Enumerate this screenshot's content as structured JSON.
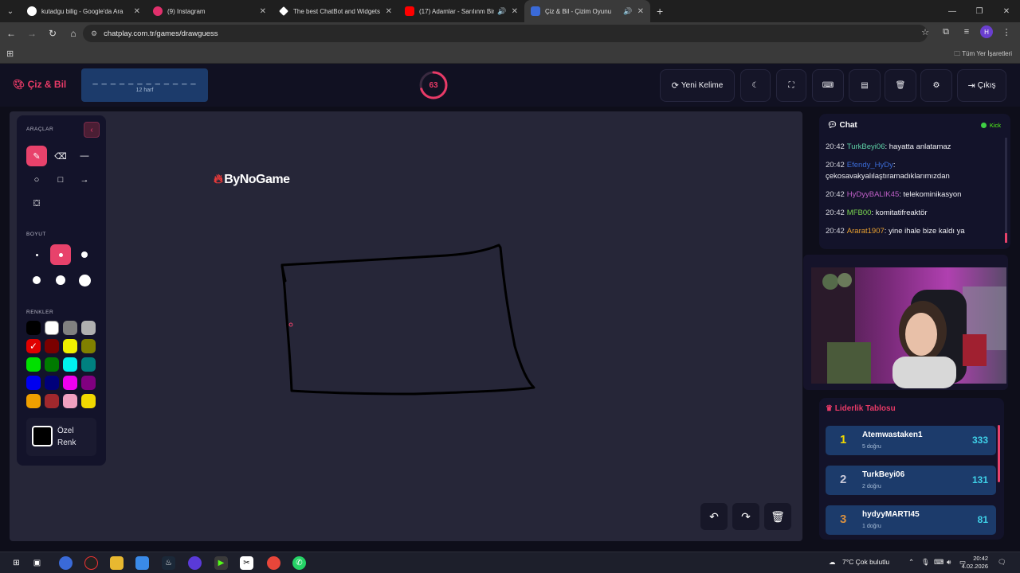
{
  "browser": {
    "tabs": [
      {
        "label": "kutadgu bilig - Google'da Ara",
        "color": "#ffffff",
        "icon": "google-icon"
      },
      {
        "label": "(9) Instagram",
        "color": "#e1306c",
        "icon": "instagram-icon"
      },
      {
        "label": "The best ChatBot and Widgets",
        "color": "#ffffff",
        "icon": "diamond-icon"
      },
      {
        "label": "(17) Adamlar - Sarılınm Birin",
        "color": "#ff0000",
        "icon": "youtube-icon"
      },
      {
        "label": "Çiz & Bil - Çizim Oyunu",
        "color": "#3a6ad8",
        "icon": "chatplay-icon"
      }
    ],
    "url": "chatplay.com.tr/games/drawguess",
    "bookmarks_all": "Tüm Yer İşaretleri",
    "profile_initial": "H"
  },
  "header": {
    "logo": "Çiz & Bil",
    "word_mask": "_ _ _ _ _ _ _ _ _ _ _ _",
    "letter_count": "12 harf",
    "timer": "63",
    "timer_fraction": 0.7,
    "new_word": "Yeni Kelime",
    "logout": "Çıkış"
  },
  "tools": {
    "section_tools": "ARAÇLAR",
    "section_size": "BOYUT",
    "section_colors": "RENKLER",
    "colors": [
      "#000000",
      "#ffffff",
      "#808080",
      "#b0b0b0",
      "#e00000",
      "#7a0000",
      "#f0f000",
      "#808000",
      "#00e000",
      "#007a00",
      "#00f0f0",
      "#008080",
      "#0000f0",
      "#00007a",
      "#f000f0",
      "#800080",
      "#f0a000",
      "#a0282d",
      "#f0a0c0",
      "#f0d800"
    ],
    "selected_color": "#e00000",
    "custom_label_1": "Özel",
    "custom_label_2": "Renk"
  },
  "canvas": {
    "watermark": "ByNoGame"
  },
  "chat": {
    "title": "Chat",
    "source": "Kick",
    "messages": [
      {
        "time": "20:42",
        "user": "TurkBeyi06",
        "color": "#5fd4a8",
        "text": "hayatta anlatamaz"
      },
      {
        "time": "20:42",
        "user": "Efendy_HyDy",
        "color": "#3b6cd8",
        "text": "çekosavakyalılaştıramadıklarımızdan"
      },
      {
        "time": "20:42",
        "user": "HyDyyBALIK45",
        "color": "#c060c8",
        "text": "telekominikasyon"
      },
      {
        "time": "20:42",
        "user": "MFB00",
        "color": "#7cd850",
        "text": "komitatifreaktör"
      },
      {
        "time": "20:42",
        "user": "Ararat1907",
        "color": "#e8a030",
        "text": "yine ihale bize kaldı ya"
      }
    ]
  },
  "leaderboard": {
    "title": "Liderlik Tablosu",
    "rows": [
      {
        "rank": "1",
        "name": "Atemwastaken1",
        "correct": "5 doğru",
        "score": "333",
        "rank_color": "#f0d800"
      },
      {
        "rank": "2",
        "name": "TurkBeyi06",
        "correct": "2 doğru",
        "score": "131",
        "rank_color": "#c8c8d8"
      },
      {
        "rank": "3",
        "name": "hydyyMARTI45",
        "correct": "1 doğru",
        "score": "81",
        "rank_color": "#d89040"
      }
    ]
  },
  "taskbar": {
    "weather": "7°C  Çok bulutlu",
    "time": "20:42",
    "date": "4.02.2026"
  }
}
